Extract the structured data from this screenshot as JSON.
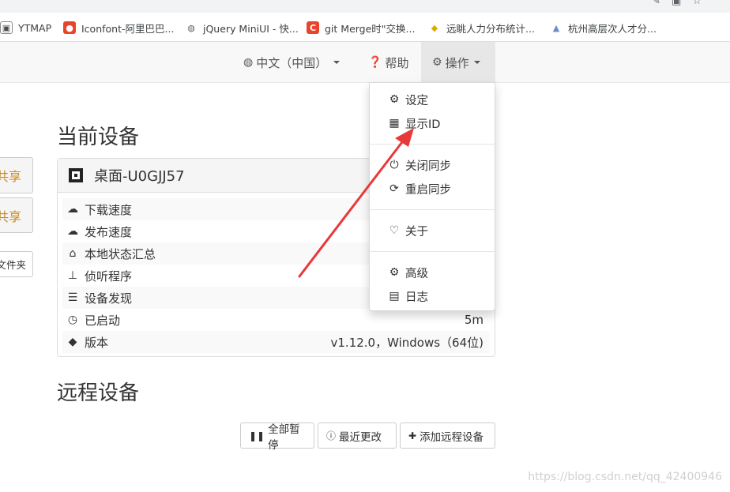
{
  "bookmarks": [
    {
      "label": "YTMAP",
      "icon": "ytmap-favicon-icon",
      "color": "#4a4a4a"
    },
    {
      "label": "Iconfont-阿里巴巴...",
      "icon": "iconfont-favicon-icon",
      "color": "#e8442b"
    },
    {
      "label": "jQuery MiniUI - 快...",
      "icon": "globe-favicon-icon",
      "color": "#5f6368"
    },
    {
      "label": "git Merge时\"交换...",
      "icon": "csdn-favicon-icon",
      "color": "#e8442b"
    },
    {
      "label": "远眺人力分布统计...",
      "icon": "colorful-favicon-icon",
      "color": "#e0a800"
    },
    {
      "label": "杭州高层次人才分...",
      "icon": "mountain-favicon-icon",
      "color": "#6a8ccc"
    }
  ],
  "navbar": {
    "language_label": "中文（中国）",
    "help_label": "帮助",
    "actions_label": "操作"
  },
  "actions_menu": {
    "items": [
      {
        "label": "设定",
        "icon": "gear-icon"
      },
      {
        "label": "显示ID",
        "icon": "qrcode-icon"
      },
      {
        "label": "关闭同步",
        "icon": "power-icon"
      },
      {
        "label": "重启同步",
        "icon": "refresh-icon"
      },
      {
        "label": "关于",
        "icon": "heart-icon"
      },
      {
        "label": "高级",
        "icon": "gears-icon"
      },
      {
        "label": "日志",
        "icon": "document-icon"
      }
    ]
  },
  "side_buttons": [
    "共享",
    "共享",
    "文件夹"
  ],
  "current_device": {
    "heading": "当前设备",
    "name": "桌面-U0GJJ57",
    "rows": [
      {
        "label": "下载速度",
        "icon": "cloud-download-icon",
        "value": ""
      },
      {
        "label": "发布速度",
        "icon": "cloud-upload-icon",
        "value": ""
      },
      {
        "label": "本地状态汇总",
        "icon": "home-icon",
        "value": ""
      },
      {
        "label": "侦听程序",
        "icon": "sitemap-icon",
        "value": ""
      },
      {
        "label": "设备发现",
        "icon": "signpost-icon",
        "value": ""
      },
      {
        "label": "已启动",
        "icon": "clock-icon",
        "value": "5m"
      },
      {
        "label": "版本",
        "icon": "tag-icon",
        "value": "v1.12.0，Windows（64位)"
      }
    ]
  },
  "remote_devices": {
    "heading": "远程设备",
    "buttons": [
      {
        "label": "全部暂停",
        "icon": "pause-icon"
      },
      {
        "label": "最近更改",
        "icon": "info-icon"
      },
      {
        "label": "添加远程设备",
        "icon": "plus-icon"
      }
    ]
  },
  "watermark": "https://blog.csdn.net/qq_42400946",
  "colors": {
    "annotation_arrow": "#e8393a",
    "share_button_text": "#c98a1f"
  }
}
